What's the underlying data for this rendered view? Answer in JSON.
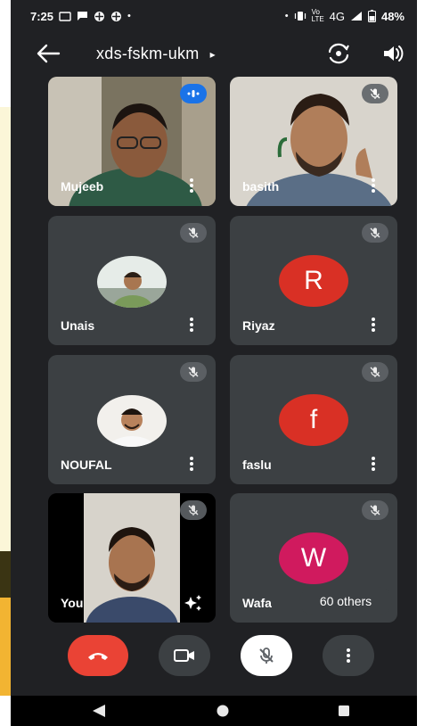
{
  "status_bar": {
    "time": "7:25",
    "network": "4G",
    "volte": "Vo LTE",
    "battery": "48%"
  },
  "header": {
    "title": "xds-fskm-ukm",
    "caret": "▸"
  },
  "participants": [
    {
      "name": "Mujeeb",
      "state": "speaking"
    },
    {
      "name": "basith",
      "state": "muted"
    },
    {
      "name": "Unais",
      "state": "muted"
    },
    {
      "name": "Riyaz",
      "state": "muted",
      "initial": "R",
      "color": "#d93025"
    },
    {
      "name": "NOUFAL",
      "state": "muted"
    },
    {
      "name": "faslu",
      "state": "muted",
      "initial": "f",
      "color": "#d93025"
    },
    {
      "name": "You",
      "state": "muted"
    },
    {
      "name": "Wafa",
      "state": "muted",
      "initial": "W",
      "color": "#d01a5e"
    }
  ],
  "others_label": "60 others",
  "controls": {
    "end_call_color": "#ea4335",
    "mic_bg": "#ffffff",
    "btn_bg": "#3c4043"
  },
  "icons": {
    "back": "arrow-left-icon",
    "switch_camera": "switch-camera-icon",
    "speaker": "speaker-icon",
    "more": "more-vert-icon",
    "mic_off": "mic-off-icon",
    "end_call": "end-call-icon",
    "camera": "camera-icon",
    "effects": "sparkle-icon"
  }
}
